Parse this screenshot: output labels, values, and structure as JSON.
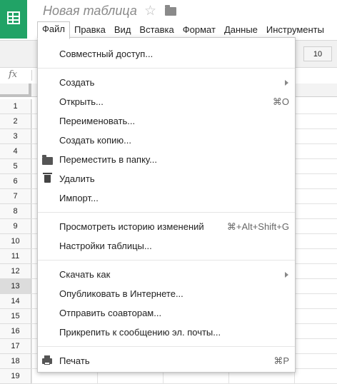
{
  "header": {
    "title": "Новая таблица",
    "star_glyph": "☆",
    "menus": [
      "Файл",
      "Правка",
      "Вид",
      "Вставка",
      "Формат",
      "Данные",
      "Инструменты"
    ],
    "active_menu": "Файл"
  },
  "toolbar": {
    "font_size": "10"
  },
  "formula_bar": {
    "fx_label": "fx"
  },
  "rows": [
    "1",
    "2",
    "3",
    "4",
    "5",
    "6",
    "7",
    "8",
    "9",
    "10",
    "11",
    "12",
    "13",
    "14",
    "15",
    "16",
    "17",
    "18",
    "19"
  ],
  "selected_row": "13",
  "file_menu": {
    "share": "Совместный доступ...",
    "create": "Создать",
    "open": "Открыть...",
    "open_shortcut": "⌘O",
    "rename": "Переименовать...",
    "copy": "Создать копию...",
    "move": "Переместить в папку...",
    "delete": "Удалить",
    "import": "Импорт...",
    "history": "Просмотреть историю изменений",
    "history_shortcut": "⌘+Alt+Shift+G",
    "settings": "Настройки таблицы...",
    "download": "Скачать как",
    "publish": "Опубликовать в Интернете...",
    "email_collab": "Отправить соавторам...",
    "attach_email": "Прикрепить к сообщению эл. почты...",
    "print": "Печать",
    "print_shortcut": "⌘P"
  },
  "colors": {
    "brand_green": "#21a366",
    "menu_border": "#c6c6c6",
    "selected_row_bg": "#dcdcdc"
  }
}
